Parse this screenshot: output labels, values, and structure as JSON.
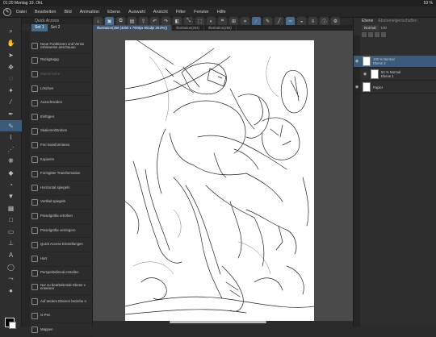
{
  "status": {
    "time": "01:20",
    "date": "Montag 19. Okt.",
    "battery": "53 %"
  },
  "menu": [
    "Datei",
    "Bearbeiten",
    "Bild",
    "Animation",
    "Ebene",
    "Auswahl",
    "Ansicht",
    "Filter",
    "Fenster",
    "Hilfe"
  ],
  "quick_access": {
    "title": "Quick Access",
    "sets": [
      "Set 1",
      "Set 2"
    ],
    "items": [
      "Neue Funktionen und Versio nshinweise anschauen",
      "Rückgängig",
      "Wiederholen",
      "Löschen",
      "Ausschneiden",
      "Einfügen",
      "Skalieren/Drehen",
      "Frei transformieren",
      "Kopieren",
      "Formgitter Transformation",
      "Horizontal spiegeln",
      "Vertikal spiegeln",
      "Pinselgröße erhöhen",
      "Pinselgröße verringern",
      "Quick Access Einstellungen",
      "Hart",
      "Perspektivlineal erstellen",
      "Nur zu bearbeitende Ebene v erweisen",
      "Auf andere Ebenen beziehe n",
      "G-Pen",
      "Mappen"
    ]
  },
  "tabs": [
    "Illustration(256 (3000 x 7000px 601dpi 29.0%))",
    "Illustration(254)",
    "Illustration(256)"
  ],
  "layers_panel": {
    "tabs": [
      "Ebene",
      "Ebeneneigenschaften"
    ],
    "blend": "Normal",
    "opacity": "100",
    "layers": [
      {
        "name": "100 % Normal",
        "sub": "Ebene 2",
        "selected": true
      },
      {
        "name": "50 % Normal",
        "sub": "Ebene 1",
        "selected": false
      },
      {
        "name": "Papier",
        "sub": "",
        "selected": false
      }
    ]
  },
  "colors": {
    "accent": "#4a6a8a"
  }
}
